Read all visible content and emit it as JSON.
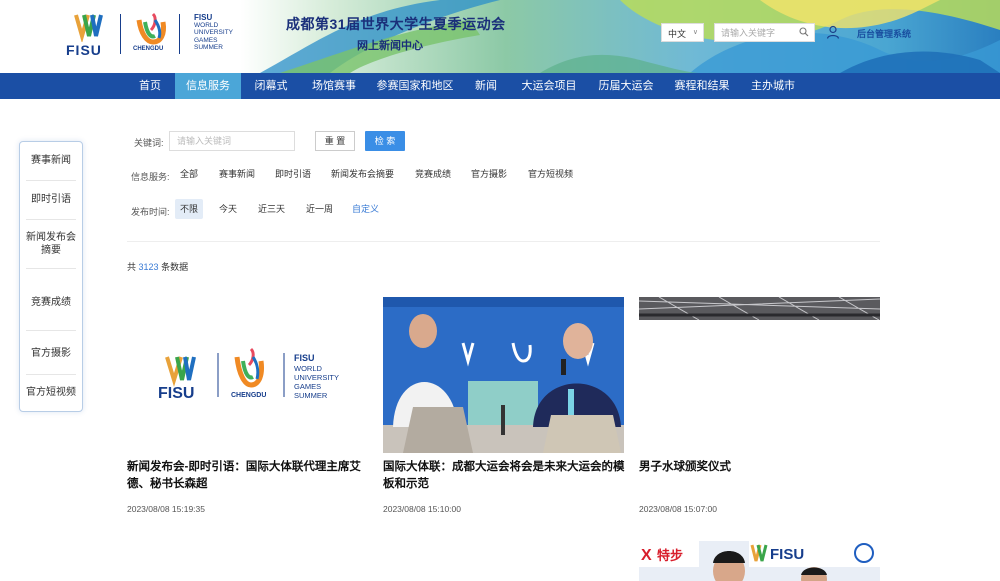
{
  "header": {
    "logo": {
      "fisu": "FISU",
      "chengdu": "CHENGDU",
      "world_lines": [
        "FISU",
        "WORLD",
        "UNIVERSITY",
        "GAMES",
        "SUMMER"
      ]
    },
    "title": "成都第31届世界大学生夏季运动会",
    "subtitle": "网上新闻中心",
    "language": "中文",
    "search_placeholder": "请输入关键字",
    "admin_link": "后台管理系统"
  },
  "nav": {
    "items": [
      "首页",
      "信息服务",
      "闭幕式",
      "场馆赛事",
      "参赛国家和地区",
      "新闻",
      "大运会项目",
      "历届大运会",
      "赛程和结果",
      "主办城市"
    ],
    "active_index": 1
  },
  "sidebar": {
    "items": [
      "赛事新闻",
      "即时引语",
      "新闻发布会摘要",
      "竞赛成绩",
      "官方摄影",
      "官方短视频"
    ]
  },
  "filters": {
    "keyword_label": "关键词:",
    "keyword_placeholder": "请输入关键词",
    "reset_label": "重 置",
    "search_label": "检 索",
    "service_label": "信息服务:",
    "service_options": [
      "全部",
      "赛事新闻",
      "即时引语",
      "新闻发布会摘要",
      "竞赛成绩",
      "官方摄影",
      "官方短视频"
    ],
    "time_label": "发布时间:",
    "time_options": [
      "不限",
      "今天",
      "近三天",
      "近一周",
      "自定义"
    ]
  },
  "results": {
    "prefix": "共",
    "count": "3123",
    "suffix": "条数据"
  },
  "cards": [
    {
      "title": "新闻发布会-即时引语：国际大体联代理主席艾德、秘书长森超",
      "date": "2023/08/08 15:19:35"
    },
    {
      "title": "国际大体联：成都大运会将会是未来大运会的模板和示范",
      "date": "2023/08/08 15:10:00"
    },
    {
      "title": "男子水球颁奖仪式",
      "date": "2023/08/08 15:07:00"
    }
  ],
  "partial_card": {
    "banner_text": "特步",
    "fisu": "FISU"
  },
  "colors": {
    "nav_bg": "#1b4fa5",
    "nav_active": "#4ba6d8",
    "accent": "#3a8ee6",
    "brand": "#173e8c"
  }
}
